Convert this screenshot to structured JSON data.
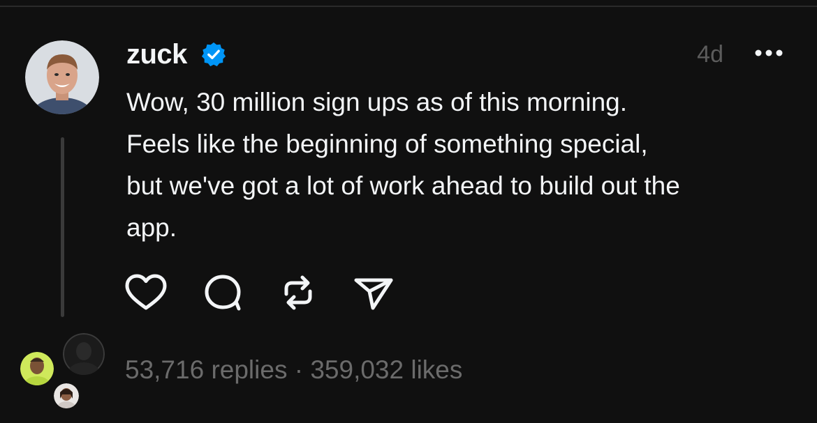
{
  "post": {
    "username": "zuck",
    "verified": true,
    "time": "4d",
    "more_icon": "more-horizontal-icon",
    "text": "Wow, 30 million sign ups as of this morning.\nFeels like the beginning of something special,\nbut we've got a lot of work ahead to build out the\napp."
  },
  "actions": {
    "like_icon": "heart-icon",
    "reply_icon": "comment-bubble-icon",
    "repost_icon": "repost-icon",
    "share_icon": "send-icon"
  },
  "stats": {
    "replies": "53,716 replies",
    "separator": " · ",
    "likes": "359,032 likes"
  },
  "colors": {
    "background": "#101010",
    "text": "#f3f5f7",
    "muted": "#6b6b6b",
    "verified": "#0095f6",
    "thread_line": "#3a3a3a"
  }
}
